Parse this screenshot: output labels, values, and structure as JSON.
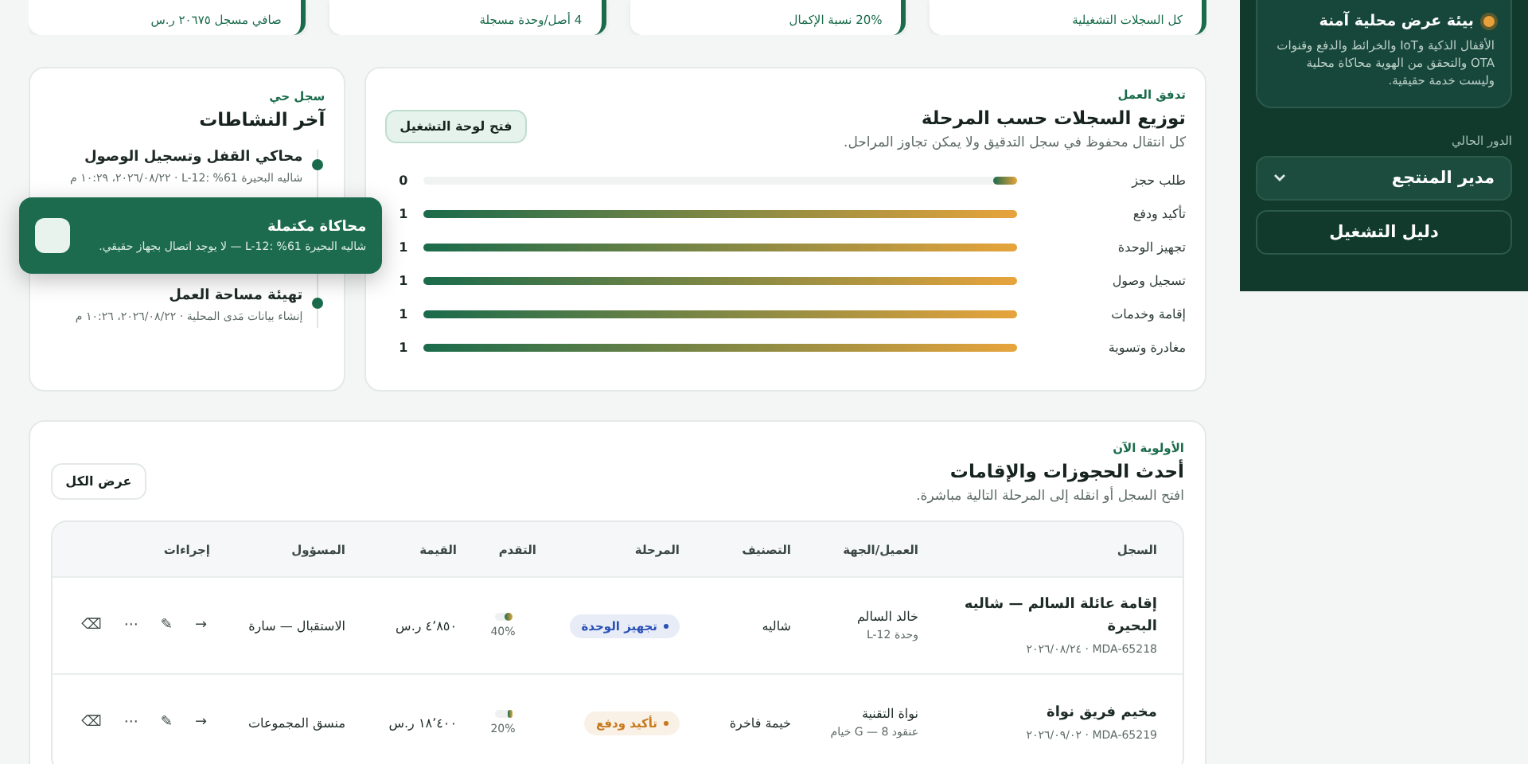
{
  "stats": [
    {
      "text": "كل السجلات التشغيلية"
    },
    {
      "text": "20% نسبة الإكمال"
    },
    {
      "text": "4 أصل/وحدة مسجلة"
    },
    {
      "text": "صافي مسجل ٢٠٦٧٥ ر.س"
    }
  ],
  "sidebar": {
    "notice": {
      "title": "بيئة عرض محلية آمنة",
      "text": "الأقفال الذكية وIoT والخرائط والدفع وقنوات OTA والتحقق من الهوية محاكاة محلية وليست خدمة حقيقية."
    },
    "role_label": "الدور الحالي",
    "role_value": "مدير المنتجع",
    "guide_button": "دليل التشغيل"
  },
  "workflow": {
    "eyebrow": "تدفق العمل",
    "title": "توزيع السجلات حسب المرحلة",
    "subtitle": "كل انتقال محفوظ في سجل التدقيق ولا يمكن تجاوز المراحل.",
    "button": "فتح لوحة التشغيل",
    "stages": [
      {
        "label": "طلب حجز",
        "count": "0",
        "level": 0.04
      },
      {
        "label": "تأكيد ودفع",
        "count": "1",
        "level": 1
      },
      {
        "label": "تجهيز الوحدة",
        "count": "1",
        "level": 1
      },
      {
        "label": "تسجيل وصول",
        "count": "1",
        "level": 1
      },
      {
        "label": "إقامة وخدمات",
        "count": "1",
        "level": 1
      },
      {
        "label": "مغادرة وتسوية",
        "count": "1",
        "level": 1
      }
    ]
  },
  "activity": {
    "eyebrow": "سجل حي",
    "title": "آخر النشاطات",
    "items": [
      {
        "title": "محاكي القفل وتسجيل الوصول",
        "meta": "شاليه البحيرة 61% :L-12 · ٢٠٢٦/٠٨/٢٢، ١٠:٢٩ م"
      },
      {
        "title": "تهيئة مساحة العمل",
        "meta": "إنشاء بيانات مَدى المحلية · ٢٠٢٦/٠٨/٢٢، ١٠:٢٦ م"
      }
    ]
  },
  "toast": {
    "title": "محاكاة مكتملة",
    "text": "شاليه البحيرة 61% :L-12 — لا يوجد اتصال بجهاز حقيقي."
  },
  "bookings": {
    "eyebrow": "الأولوية الآن",
    "title": "أحدث الحجوزات والإقامات",
    "subtitle": "افتح السجل أو انقله إلى المرحلة التالية مباشرة.",
    "button": "عرض الكل",
    "columns": [
      "السجل",
      "العميل/الجهة",
      "التصنيف",
      "المرحلة",
      "التقدم",
      "القيمة",
      "المسؤول",
      "إجراءات"
    ],
    "rows": [
      {
        "title": "إقامة عائلة السالم — شاليه البحيرة",
        "ref": "MDA-65218 · ٢٠٢٦/٠٨/٢٤",
        "client": "خالد السالم",
        "client_sub": "وحدة L-12",
        "category": "شاليه",
        "stage": "تجهيز الوحدة",
        "color": "#2950b5",
        "progress": "40%",
        "level": 0.4,
        "value": "٤٬٨٥٠ ر.س",
        "owner": "الاستقبال — سارة",
        "actions": [
          "→",
          "✎",
          "⋯",
          "⌫"
        ]
      },
      {
        "title": "مخيم فريق نواة",
        "ref": "MDA-65219 · ٢٠٢٦/٠٩/٠٢",
        "client": "نواة التقنية",
        "client_sub": "عنقود G — 8 خيام",
        "category": "خيمة فاخرة",
        "stage": "تأكيد ودفع",
        "color": "#c7781a",
        "progress": "20%",
        "level": 0.2,
        "value": "١٨٬٤٠٠ ر.س",
        "owner": "منسق المجموعات",
        "actions": [
          "→",
          "✎",
          "⋯",
          "⌫"
        ]
      }
    ]
  }
}
